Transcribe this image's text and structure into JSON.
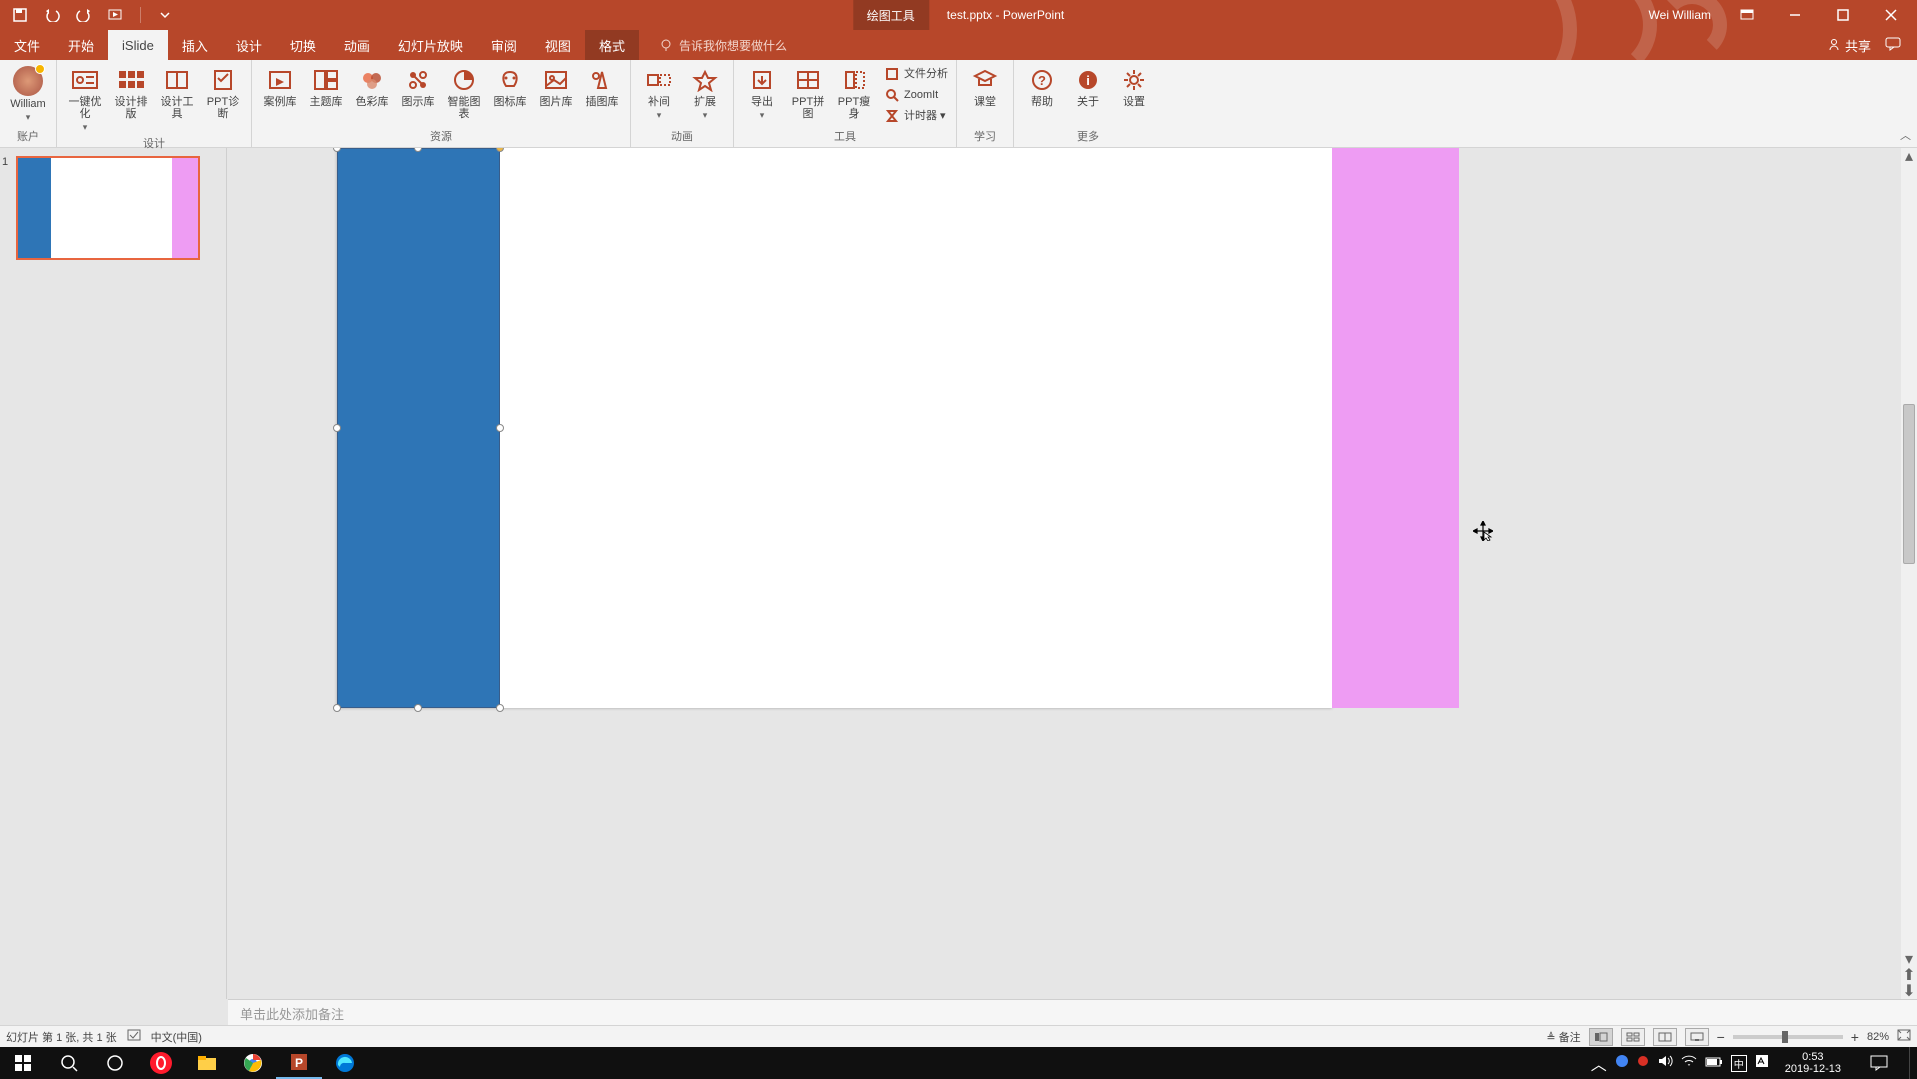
{
  "titlebar": {
    "context_tool": "绘图工具",
    "filename": "test.pptx",
    "app": "PowerPoint",
    "user": "Wei William"
  },
  "tabs": {
    "file": "文件",
    "home": "开始",
    "islide": "iSlide",
    "insert": "插入",
    "design": "设计",
    "transition": "切换",
    "animation": "动画",
    "slideshow": "幻灯片放映",
    "review": "审阅",
    "view": "视图",
    "format": "格式",
    "tell_me": "告诉我你想要做什么",
    "share": "共享"
  },
  "ribbon": {
    "account": {
      "william": "William",
      "group": "账户"
    },
    "design": {
      "opt": "一键优化",
      "layout": "设计排版",
      "tools": "设计工具",
      "diag": "PPT诊断",
      "group": "设计"
    },
    "resource": {
      "case": "案例库",
      "theme": "主题库",
      "color": "色彩库",
      "diagram": "图示库",
      "smart": "智能图表",
      "icon": "图标库",
      "pic": "图片库",
      "vector": "插图库",
      "group": "资源"
    },
    "anim": {
      "tween": "补间",
      "ext": "扩展",
      "group": "动画"
    },
    "tools": {
      "export": "导出",
      "merge": "PPT拼图",
      "slim": "PPT瘦身",
      "fileanalysis": "文件分析",
      "zoomit": "ZoomIt",
      "timer": "计时器",
      "group": "工具"
    },
    "learn": {
      "class": "课堂",
      "group": "学习"
    },
    "more": {
      "help": "帮助",
      "about": "关于",
      "settings": "设置",
      "group": "更多"
    }
  },
  "thumb": {
    "num": "1"
  },
  "notes": {
    "placeholder": "单击此处添加备注"
  },
  "status": {
    "slide": "幻灯片 第 1 张, 共 1 张",
    "lang": "中文(中国)",
    "notes": "备注",
    "zoom": "82%"
  },
  "taskbar": {
    "time": "0:53",
    "date": "2019-12-13",
    "ime": "中"
  }
}
